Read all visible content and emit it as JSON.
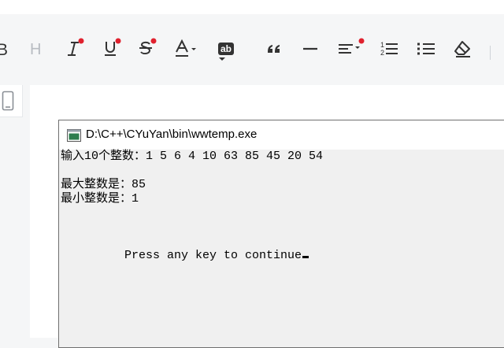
{
  "toolbar": {
    "items": [
      {
        "name": "bold-icon",
        "label": "B"
      },
      {
        "name": "heading-icon",
        "label": "H"
      },
      {
        "name": "italic-icon",
        "label": "I"
      },
      {
        "name": "underline-icon",
        "label": "U"
      },
      {
        "name": "strikethrough-icon",
        "label": "S"
      },
      {
        "name": "font-color-icon",
        "label": "A"
      },
      {
        "name": "highlight-icon",
        "label": "ab"
      },
      {
        "name": "quote-icon",
        "label": "❝"
      },
      {
        "name": "horizontal-rule-icon",
        "label": "—"
      },
      {
        "name": "align-icon",
        "label": ""
      },
      {
        "name": "ordered-list-icon",
        "label": "1 2"
      },
      {
        "name": "unordered-list-icon",
        "label": ""
      },
      {
        "name": "eraser-icon",
        "label": ""
      }
    ],
    "accent_color": "#e0212e"
  },
  "console": {
    "title": "D:\\C++\\CYuYan\\bin\\wwtemp.exe",
    "lines": [
      "输入10个整数：1 5 6 4 10 63 85 45 20 54",
      "",
      "最大整数是：85",
      "最小整数是：1",
      "",
      "",
      "",
      "         Press any key to continue"
    ]
  }
}
